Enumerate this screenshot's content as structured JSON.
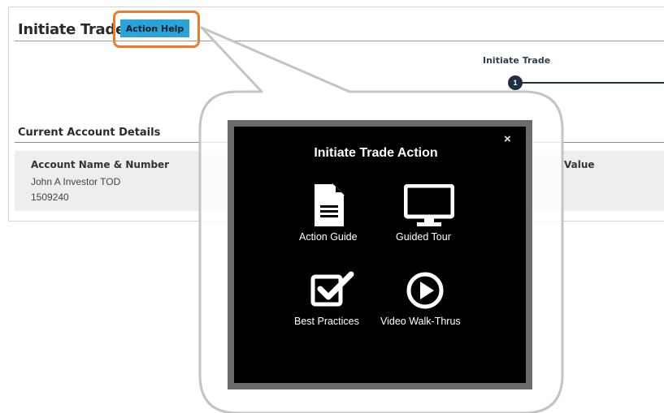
{
  "page": {
    "title": "Initiate Trade",
    "help_button": "Action Help",
    "step": {
      "label": "Initiate Trade",
      "number": "1"
    },
    "section_title": "Current Account Details",
    "account": {
      "header": "Account Name & Number",
      "name": "John A Investor TOD",
      "number": "1509240",
      "value_header": "Value"
    }
  },
  "modal": {
    "title": "Initiate Trade Action",
    "close": "×",
    "items": [
      {
        "label": "Action Guide",
        "icon": "document-icon"
      },
      {
        "label": "Guided Tour",
        "icon": "monitor-icon"
      },
      {
        "label": "Best Practices",
        "icon": "checkbox-icon"
      },
      {
        "label": "Video Walk-Thrus",
        "icon": "play-icon"
      }
    ]
  },
  "colors": {
    "help_button": "#2aa3d9",
    "highlight": "#ee7a2a",
    "step_dot": "#1c2f44",
    "modal_bg": "#000000"
  }
}
